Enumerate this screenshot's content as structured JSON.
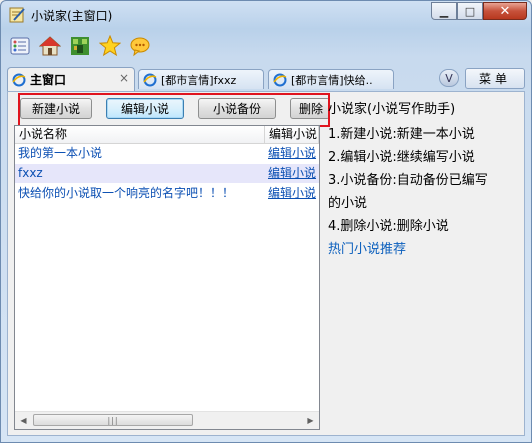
{
  "window": {
    "title": "小说家(主窗口)"
  },
  "toolbar": {
    "icons": [
      "list-icon",
      "home-icon",
      "game-icon",
      "star-icon",
      "chat-bubble-icon"
    ]
  },
  "tabs": [
    {
      "label": "主窗口",
      "active": true,
      "close": "×"
    },
    {
      "label": "[都市言情]fxxz",
      "active": false
    },
    {
      "label": "[都市言情]快给..",
      "active": false
    }
  ],
  "tabbar": {
    "v_label": "V",
    "menu_label": "菜单"
  },
  "actions": {
    "new_novel": "新建小说",
    "edit_novel": "编辑小说",
    "backup_novel": "小说备份",
    "delete_novel": "删除"
  },
  "list": {
    "columns": [
      "小说名称",
      "编辑小说"
    ],
    "rows": [
      {
        "name": "我的第一本小说",
        "action": "编辑小说",
        "selected": false
      },
      {
        "name": "fxxz",
        "action": "编辑小说",
        "selected": true
      },
      {
        "name": "快给你的小说取一个响亮的名字吧！！！",
        "action": "编辑小说",
        "selected": false
      }
    ],
    "scroll_grip": "|||"
  },
  "help": {
    "title": "小说家(小说写作助手)",
    "items": [
      "1.新建小说:新建一本小说",
      "2.编辑小说:继续编写小说",
      "3.小说备份:自动备份已编写",
      "的小说",
      "4.删除小说:删除小说"
    ],
    "link": "热门小说推荐"
  },
  "colors": {
    "highlight_border": "#e0141e",
    "link": "#0b5fbd",
    "selected_row": "#e6e6fa"
  }
}
